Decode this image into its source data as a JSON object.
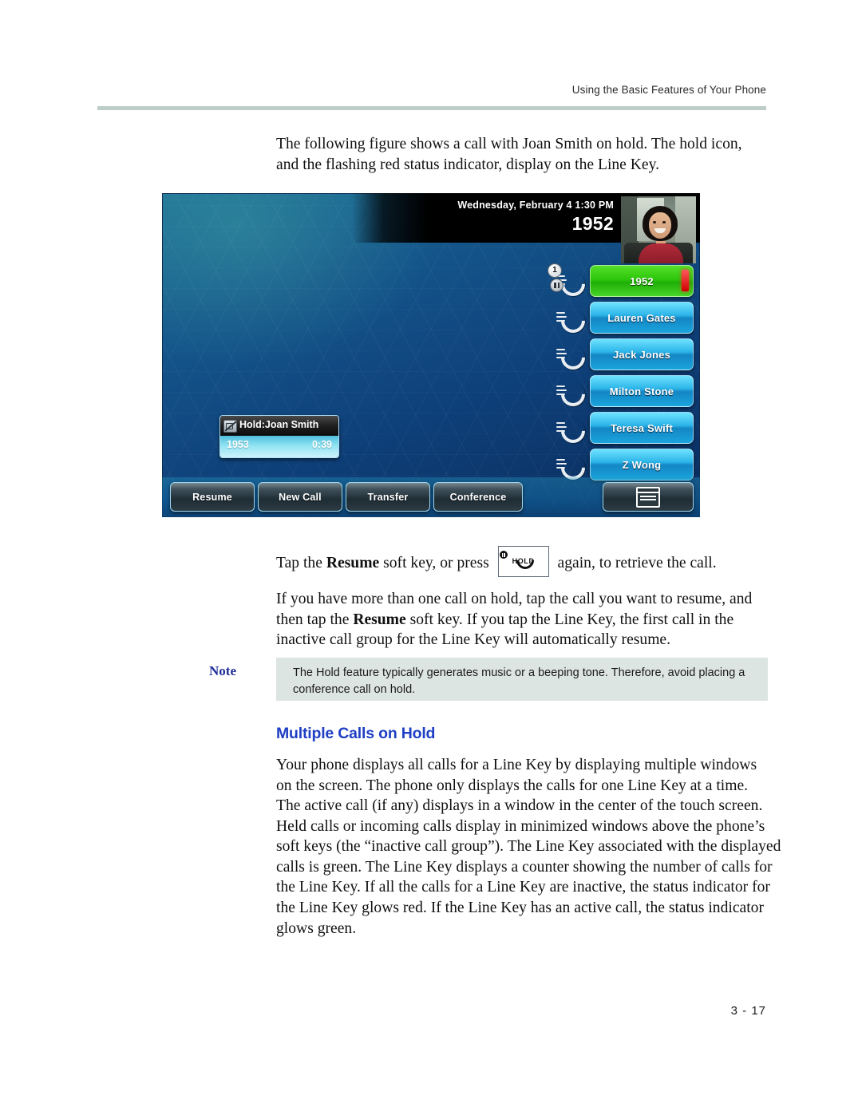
{
  "header": {
    "running_head": "Using the Basic Features of Your Phone"
  },
  "body": {
    "intro_paragraph": "The following figure shows a call with Joan Smith on hold. The hold icon, and the flashing red status indicator, display on the Line Key.",
    "resume_sentence_before": "Tap the ",
    "resume_bold": "Resume",
    "resume_sentence_mid": " soft key, or press",
    "resume_sentence_after": "again, to retrieve the call.",
    "multi_hold_before": "If you have more than one call on hold, tap the call you want to resume, and then tap the ",
    "multi_hold_bold": "Resume",
    "multi_hold_after": " soft key. If you tap the Line Key, the first call in the inactive call group for the Line Key will automatically resume.",
    "section_heading": "Multiple Calls on Hold",
    "paragraph_displays": "Your phone displays all calls for a Line Key by displaying multiple windows on the screen. The phone only displays the calls for one Line Key at a time.",
    "paragraph_active_call": "The active call (if any) displays in a window in the center of the touch screen. Held calls or incoming calls display in minimized windows above the phone’s soft keys (the “inactive call group”). The Line Key associated with the displayed calls is green. The Line Key displays a counter showing the number of calls for the Line Key. If all the calls for a Line Key are inactive, the status indicator for the Line Key glows red. If the Line Key has an active call, the status indicator glows green."
  },
  "hold_key_graphic": {
    "label": "HOLD"
  },
  "note": {
    "label": "Note",
    "text": "The Hold feature typically generates music or a beeping tone. Therefore, avoid placing a conference call on hold."
  },
  "phone_figure": {
    "status_bar": {
      "datetime": "Wednesday, February 4  1:30 PM",
      "extension": "1952"
    },
    "line_keys": [
      {
        "label": "1952",
        "state": "active-held",
        "counter": "1",
        "status_indicator_color": "#d40000",
        "key_color": "#2cc60b"
      },
      {
        "label": "Lauren Gates",
        "state": "idle",
        "key_color": "#2bb4e8"
      },
      {
        "label": "Jack Jones",
        "state": "idle",
        "key_color": "#2bb4e8"
      },
      {
        "label": "Milton Stone",
        "state": "idle",
        "key_color": "#2bb4e8"
      },
      {
        "label": "Teresa Swift",
        "state": "idle",
        "key_color": "#2bb4e8"
      },
      {
        "label": "Z Wong",
        "state": "idle",
        "key_color": "#2bb4e8"
      }
    ],
    "call_window": {
      "title": "Hold:Joan Smith",
      "number": "1953",
      "duration": "0:39",
      "icon": "video-off-icon"
    },
    "soft_keys": [
      "Resume",
      "New Call",
      "Transfer",
      "Conference"
    ],
    "menu_button_icon": "window-list-icon"
  },
  "footer": {
    "page_number": "3 - 17"
  },
  "colors": {
    "heading_blue": "#1f3fc4",
    "note_label_blue": "#1f2f9a",
    "note_background": "#dde5e3",
    "rule": "#bdcdc8",
    "line_key_active_green": "#2cc60b",
    "status_indicator_red": "#d40000"
  }
}
